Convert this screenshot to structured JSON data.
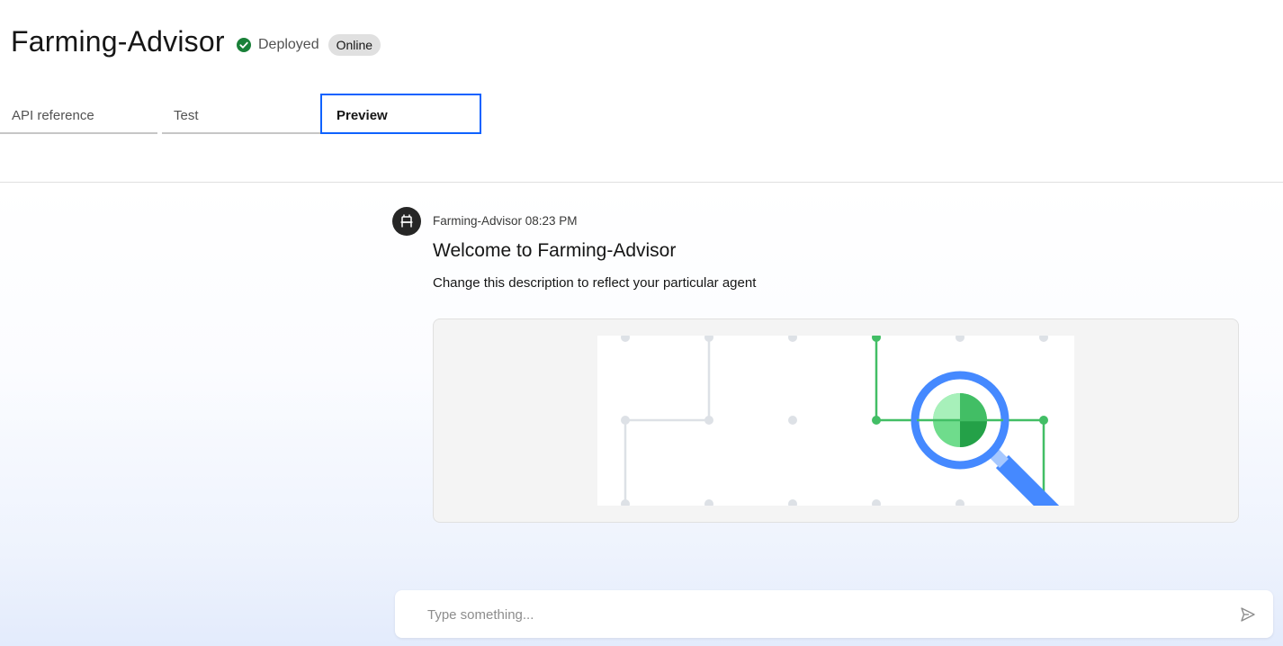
{
  "header": {
    "title": "Farming-Advisor",
    "status_label": "Deployed",
    "badge": "Online"
  },
  "tabs": [
    {
      "label": "API reference",
      "active": false
    },
    {
      "label": "Test",
      "active": false
    },
    {
      "label": "Preview",
      "active": true
    }
  ],
  "message": {
    "sender": "Farming-Advisor",
    "time": "08:23 PM",
    "meta": "Farming-Advisor 08:23 PM",
    "title": "Welcome to Farming-Advisor",
    "description": "Change this description to reflect your particular agent",
    "image": "network-search-illustration"
  },
  "input": {
    "placeholder": "Type something...",
    "value": ""
  },
  "icons": {
    "status": "checkmark-filled-icon",
    "avatar": "bot-icon",
    "send": "send-icon"
  },
  "colors": {
    "accent": "#0f62fe",
    "success": "#198038",
    "illustration_green": "#42be65",
    "illustration_blue": "#4589ff"
  }
}
